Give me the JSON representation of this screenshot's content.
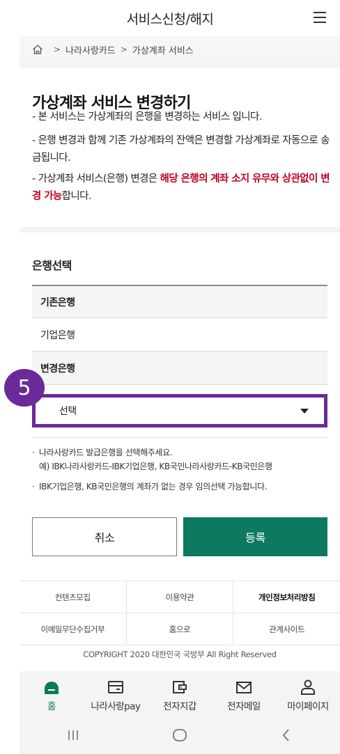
{
  "header": {
    "title": "서비스신청/해지"
  },
  "breadcrumb": {
    "items": [
      "나라사랑카드",
      "가상계좌 서비스"
    ]
  },
  "intro": {
    "title": "가상계좌 서비스 변경하기",
    "line1": "- 본 서비스는 가상계좌의 은행을 변경하는 서비스 입니다.",
    "line2": "- 은행 변경과 함께 기존 가상계좌의 잔액은 변경할 가상계좌로 자동으로 송금됩니다.",
    "line3_prefix": "- 가상계좌 서비스(은행) 변경은 ",
    "line3_highlight": "해당 은행의 계좌 소지 유무와 상관없이 변경 가능",
    "line3_suffix": "합니다."
  },
  "bank_select": {
    "section_title": "은행선택",
    "current_label": "기존은행",
    "current_value": "기업은행",
    "new_label": "변경은행",
    "select_value": "선택",
    "step_number": "5"
  },
  "notes": {
    "note1_line1": "나라사랑카드 발급은행을 선택해주세요.",
    "note1_line2": "예) IBK나라사랑카드-IBK기업은행, KB국민나라사랑카드-KB국민은행",
    "note2": "IBK기업은행, KB국민은행의 계좌가 없는 경우 임의선택 가능합니다.",
    "bullet": "·"
  },
  "buttons": {
    "cancel": "취소",
    "submit": "등록"
  },
  "footer": {
    "row1": [
      "컨텐츠모집",
      "이용약관",
      "개인정보처리방침"
    ],
    "row2": [
      "이메일무단수집거부",
      "홈으로",
      "관계사이트"
    ],
    "copyright": "COPYRIGHT 2020 대한민국 국방부 All Right Reserved"
  },
  "tabbar": {
    "items": [
      "홈",
      "나라사랑pay",
      "전자지갑",
      "전자메일",
      "마이페이지"
    ],
    "active_color": "#0b7a5f"
  },
  "colors": {
    "highlight": "#c00020",
    "badge": "#6a2a9a",
    "primary": "#0b7a5f"
  }
}
